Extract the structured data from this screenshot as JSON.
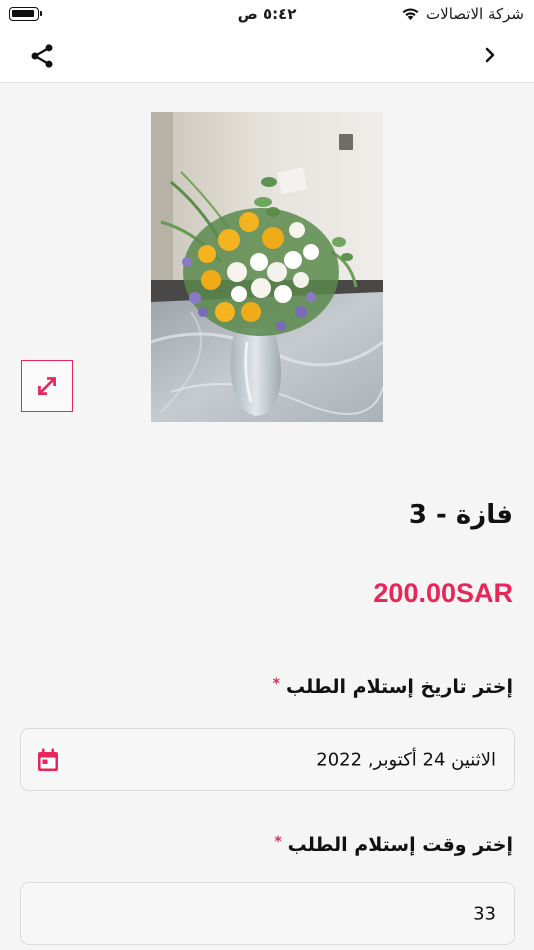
{
  "status_bar": {
    "time": "٥:٤٢ ص",
    "carrier": "شركة الاتصالات"
  },
  "nav": {
    "share_icon": "share-icon",
    "back_icon": "chevron-right-icon"
  },
  "product": {
    "title": "فازة - 3",
    "price": "200.00SAR",
    "image_alt": "flower-vase-photo"
  },
  "delivery_date": {
    "label": "إختر تاريخ إستلام الطلب",
    "required_mark": "*",
    "value": "الاثنين 24 أكتوبر, 2022"
  },
  "delivery_time": {
    "label": "إختر وقت إستلام الطلب",
    "required_mark": "*",
    "value": "33"
  },
  "colors": {
    "accent": "#e8265a",
    "background": "#f5f5f5"
  }
}
